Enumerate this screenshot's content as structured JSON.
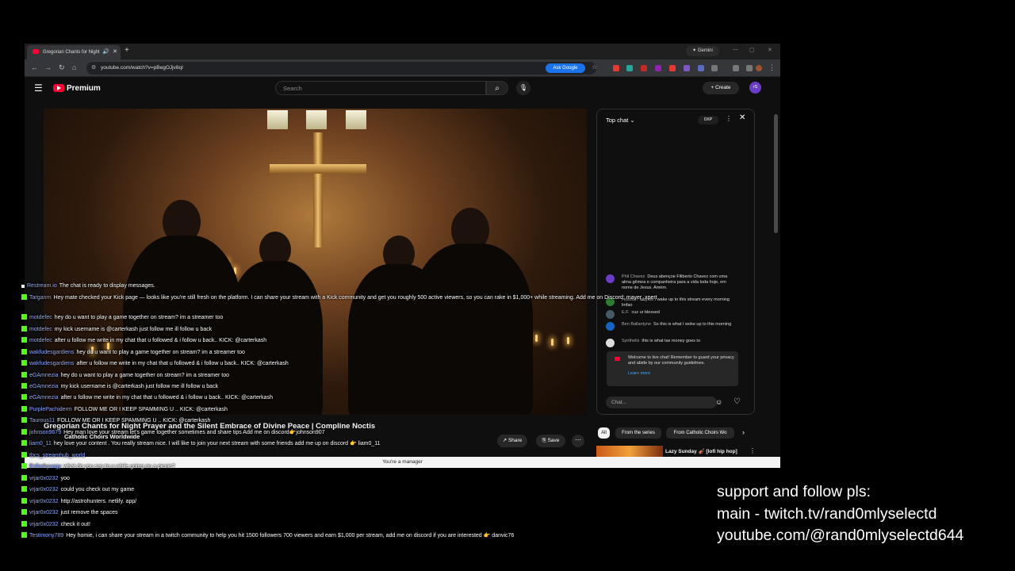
{
  "browser": {
    "tab_title": "Gregorian Chants for Night",
    "new_tab": "+",
    "gemini": "✦ Gemini",
    "url": "youtube.com/watch?v=pBegOJjv8qI",
    "ask_google": "Ask Google"
  },
  "youtube": {
    "brand": "Premium",
    "search_placeholder": "Search",
    "create": "+ Create",
    "avatar": "rS",
    "video_title": "Gregorian Chants for Night Prayer and the Silent Embrace of Divine Peace | Compline Noctis",
    "channel": "Catholic Choirs Worldwide",
    "share": "↗ Share",
    "save": "⎘ Save",
    "manager_notice": "You're a manager"
  },
  "live_chat": {
    "header": "Top chat ⌄",
    "xp": "0XP",
    "messages": [
      {
        "author": "Phil Chavez",
        "text": "Deus abençoe Filiberto Chavez com uma alma gêmea e companheira para a vida toda hoje, em nome de Jesus. Amém.",
        "color": "#6b3cc7"
      },
      {
        "author": "Hussain",
        "text": "why do i wake up to this stream every morning lmfao",
        "color": "#2e7d32"
      },
      {
        "author": "E.F.",
        "text": "cuz ur blessed",
        "color": "#455a64"
      },
      {
        "author": "Ben Ballantyne",
        "text": "So this is what I woke up to this morning",
        "color": "#1565c0"
      },
      {
        "author": "Synthelix",
        "text": "this is what tax money goes to",
        "color": "#ddd"
      }
    ],
    "welcome": "Welcome to live chat! Remember to guard your privacy and abide by our community guidelines.",
    "learn_more": "Learn more",
    "input_placeholder": "Chat..."
  },
  "chips": [
    "All",
    "From the series",
    "From Catholic Choirs Wo"
  ],
  "next_video": "Lazy Sunday 🎻 [lofi hip hop]",
  "overlay_chat": [
    {
      "user": "Restream.io",
      "text": "The chat is ready to display messages.",
      "color": "#8fa8ff"
    },
    {
      "user": "Targanrn",
      "text": "Hey mate checked your Kick page — looks like you're still fresh on the platform. I can share your stream with a Kick community and get you roughly 500 active viewers, so you can rake in $1,000+ while streaming. Add me on Discord: mayer_xpert",
      "color": "#8fa8ff"
    },
    {
      "user": "motdefec",
      "text": "hey do u want to play a game together on stream? im a streamer too",
      "color": "#8fa8ff"
    },
    {
      "user": "motdefec",
      "text": "my kick username is @carterkash just follow me ill follow u back",
      "color": "#8fa8ff"
    },
    {
      "user": "motdefec",
      "text": "after u follow me write in my chat that u followed & i follow u back.. KICK: @carterkash",
      "color": "#8fa8ff"
    },
    {
      "user": "wakfudesgardiens",
      "text": "hey do u want to play a game together on stream? im a streamer too",
      "color": "#8fa8ff"
    },
    {
      "user": "wakfudesgardiens",
      "text": "after u follow me write in my chat that u followed & i follow u back.. KICK: @carterkash",
      "color": "#8fa8ff"
    },
    {
      "user": "eGAmnezia",
      "text": "hey do u want to play a game together on stream? im a streamer too",
      "color": "#8fa8ff"
    },
    {
      "user": "eGAmnezia",
      "text": "my kick username is @carterkash just follow me ill follow u back",
      "color": "#8fa8ff"
    },
    {
      "user": "eGAmnezia",
      "text": "after u follow me write in my chat that u followed & i follow u back.. KICK: @carterkash",
      "color": "#8fa8ff"
    },
    {
      "user": "PurplePachiderm",
      "text": "FOLLOW ME OR I KEEP SPAMMING U .. KICK: @carterkash",
      "color": "#8fa8ff"
    },
    {
      "user": "Taurous11",
      "text": "FOLLOW ME OR I KEEP SPAMMING U .. KICK: @carterkash",
      "color": "#8fa8ff"
    },
    {
      "user": "johnson9679",
      "text": "Hey man love your stream let's game together sometimes and share tips Add me on discord👉johnson907",
      "color": "#8fa8ff"
    },
    {
      "user": "liam0_11",
      "text": "hey love your content . You really stream nice. I will like to join your next stream with some friends add me up on discord 👉 liam0_11",
      "color": "#8fa8ff"
    },
    {
      "user": "tbcs_streamhub_world",
      "text": "",
      "color": "#8fa8ff"
    },
    {
      "user": "Enfoshyvogy",
      "text": "what do you say to a while going on a picnic?",
      "color": "#8fa8ff"
    },
    {
      "user": "vrjar0x0232",
      "text": "yoo",
      "color": "#8fa8ff"
    },
    {
      "user": "vrjar0x0232",
      "text": "could you check out my game",
      "color": "#8fa8ff"
    },
    {
      "user": "vrjar0x0232",
      "text": "http://astrohunters. netlify. app/",
      "color": "#8fa8ff"
    },
    {
      "user": "vrjar0x0232",
      "text": "just remove the spaces",
      "color": "#8fa8ff"
    },
    {
      "user": "vrjar0x0232",
      "text": "check it out!",
      "color": "#8fa8ff"
    },
    {
      "user": "Testimony789",
      "text": "Hey homie, i can share your stream in a twitch community to help you hit 1500 followers 700 viewers and earn $1,000 per stream, add me on discord if you are interested 👉 danvic76",
      "color": "#8fa8ff"
    }
  ],
  "support": {
    "line1": "support and follow pls:",
    "line2": "main - twitch.tv/rand0mlyselectd",
    "line3": "youtube.com/@rand0mlyselectd644"
  }
}
